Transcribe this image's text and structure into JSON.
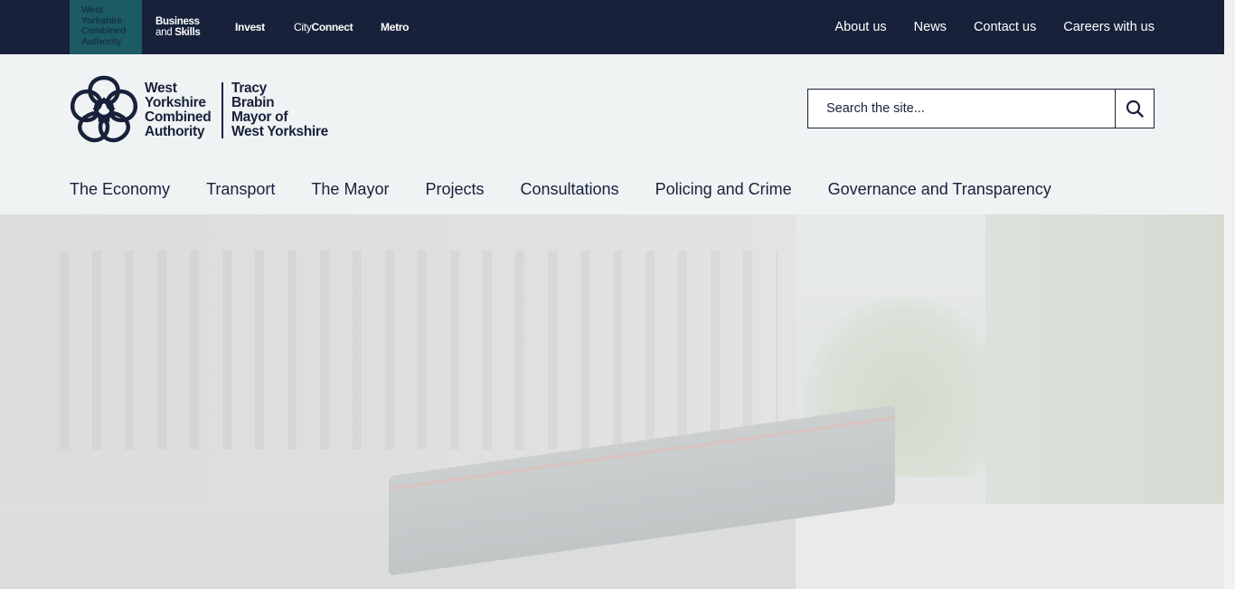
{
  "topbar": {
    "brands": {
      "wyca": [
        "West",
        "Yorkshire",
        "Combined",
        "Authority"
      ],
      "business_line1": "Business",
      "business_line2_pre": "and",
      "business_line2_bold": "Skills",
      "invest": "Invest",
      "city_pre": "City",
      "city_bold": "Connect",
      "metro": "Metro"
    },
    "links": [
      "About us",
      "News",
      "Contact us",
      "Careers with us"
    ]
  },
  "header": {
    "logo_left": [
      "West",
      "Yorkshire",
      "Combined",
      "Authority"
    ],
    "logo_right": [
      "Tracy",
      "Brabin",
      "Mayor of",
      "West Yorkshire"
    ]
  },
  "search": {
    "placeholder": "Search the site...",
    "icon": "search-icon"
  },
  "mainnav": {
    "items": [
      "The Economy",
      "Transport",
      "The Mayor",
      "Projects",
      "Consultations",
      "Policing and Crime",
      "Governance and Transparency"
    ]
  },
  "colors": {
    "navy": "#17213a",
    "teal": "#1c5b61",
    "header_bg": "#f0f3f4"
  }
}
